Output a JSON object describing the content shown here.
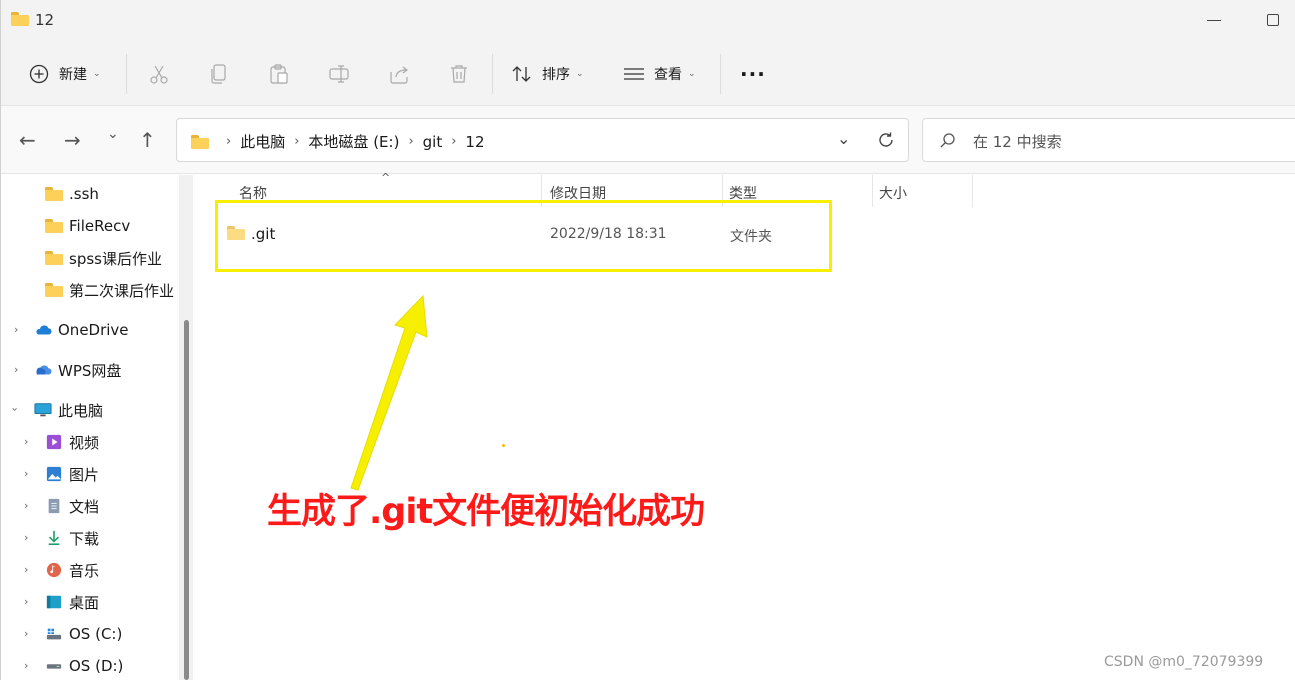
{
  "window": {
    "title": "12"
  },
  "toolbar": {
    "new_label": "新建",
    "sort_label": "排序",
    "view_label": "查看",
    "more_label": "···"
  },
  "nav": {
    "breadcrumb": [
      "此电脑",
      "本地磁盘 (E:)",
      "git",
      "12"
    ],
    "search_placeholder": "在 12 中搜索"
  },
  "sidebar": {
    "items": [
      {
        "label": ".ssh",
        "icon": "folder-icon"
      },
      {
        "label": "FileRecv",
        "icon": "folder-icon"
      },
      {
        "label": "spss课后作业",
        "icon": "folder-icon"
      },
      {
        "label": "第二次课后作业",
        "icon": "folder-icon"
      },
      {
        "label": "OneDrive",
        "icon": "cloud-icon"
      },
      {
        "label": "WPS网盘",
        "icon": "wps-cloud-icon"
      },
      {
        "label": "此电脑",
        "icon": "pc-icon"
      },
      {
        "label": "视频",
        "icon": "video-icon"
      },
      {
        "label": "图片",
        "icon": "picture-icon"
      },
      {
        "label": "文档",
        "icon": "document-icon"
      },
      {
        "label": "下载",
        "icon": "download-icon"
      },
      {
        "label": "音乐",
        "icon": "music-icon"
      },
      {
        "label": "桌面",
        "icon": "desktop-icon"
      },
      {
        "label": "OS (C:)",
        "icon": "drive-icon"
      },
      {
        "label": "OS (D:)",
        "icon": "drive-icon"
      }
    ]
  },
  "table": {
    "columns": [
      "名称",
      "修改日期",
      "类型",
      "大小"
    ],
    "rows": [
      {
        "name": ".git",
        "modified": "2022/9/18 18:31",
        "type": "文件夹",
        "size": ""
      }
    ]
  },
  "annotation": {
    "text": "生成了.git文件便初始化成功",
    "color": "#ff1a1a",
    "arrow_color": "#f6f000"
  },
  "watermark": "CSDN @m0_72079399"
}
